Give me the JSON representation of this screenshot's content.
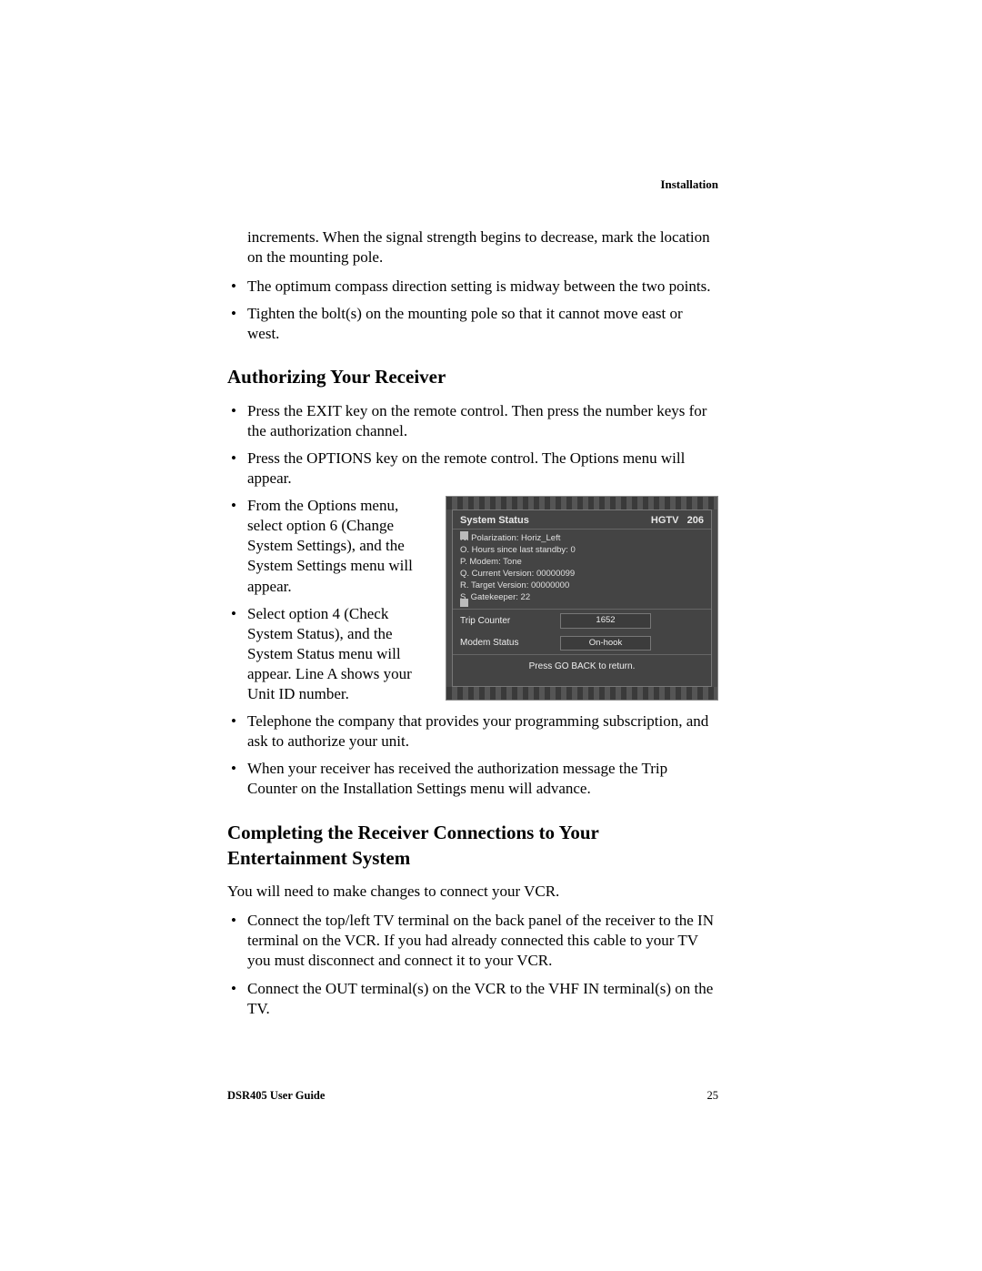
{
  "header": {
    "section": "Installation"
  },
  "intro": {
    "continuation": "increments.  When the signal strength begins to decrease, mark the location on the mounting pole.",
    "bullets": [
      "The optimum compass direction setting is midway between the two points.",
      "Tighten the bolt(s) on the mounting pole so that it cannot move east or west."
    ]
  },
  "authorizing": {
    "heading": "Authorizing Your Receiver",
    "bullets_top": [
      "Press the EXIT key on the remote control. Then press the number keys for the authorization channel.",
      "Press the OPTIONS key on the remote control. The Options menu will appear."
    ],
    "bullets_wrap": [
      "From the Options menu, select option 6 (Change System Settings), and the System Settings menu will appear.",
      "Select option 4 (Check System Status), and the System Status menu will appear. Line A shows your Unit ID number.",
      "Telephone the company that provides your programming subscription, and ask to authorize your unit."
    ],
    "bullets_bottom": [
      "When your receiver has received the authorization message the Trip Counter on the Installation Settings menu will advance."
    ]
  },
  "screenshot": {
    "title_left": "System Status",
    "title_right_a": "HGTV",
    "title_right_b": "206",
    "lines": [
      "N.  Polarization:  Horiz_Left",
      "O.  Hours since last standby:  0",
      "P.  Modem:  Tone",
      "Q.  Current Version:  00000099",
      "R.  Target Version:  00000000",
      "S.  Gatekeeper:  22"
    ],
    "row1_label": "Trip Counter",
    "row1_value": "1652",
    "row2_label": "Modem Status",
    "row2_value": "On-hook",
    "footer": "Press GO BACK to return."
  },
  "completing": {
    "heading": "Completing the Receiver Connections to Your Entertainment System",
    "para": "You will need to make changes to connect your VCR.",
    "bullets": [
      "Connect the top/left TV terminal on the back panel of the receiver to the IN terminal on the VCR. If you had already connected this cable to your TV you must disconnect and connect it to your VCR.",
      "Connect the OUT terminal(s) on the VCR to the VHF IN terminal(s) on the TV."
    ]
  },
  "footer": {
    "guide": "DSR405 User Guide",
    "page": "25"
  }
}
